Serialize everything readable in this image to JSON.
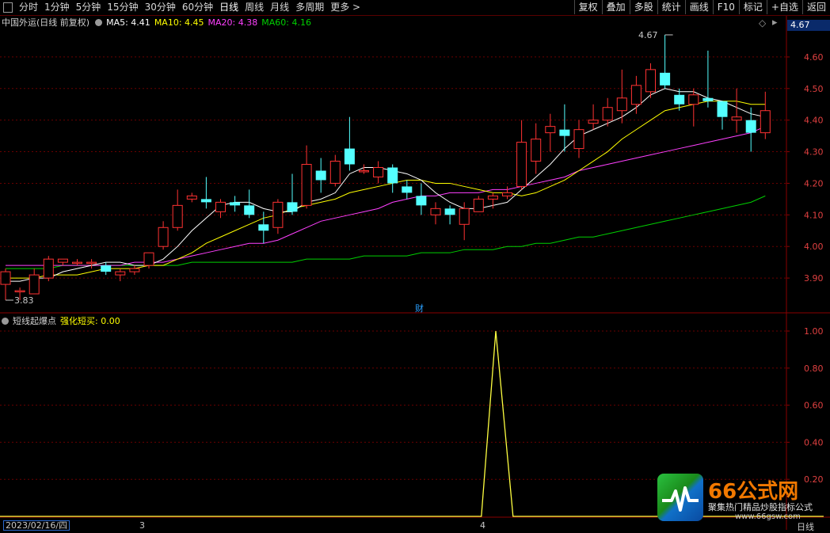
{
  "toolbar": {
    "left_items": [
      "分时",
      "1分钟",
      "5分钟",
      "15分钟",
      "30分钟",
      "60分钟",
      "日线",
      "周线",
      "月线",
      "多周期",
      "更多 >"
    ],
    "active_index": 6,
    "right_items": [
      "复权",
      "叠加",
      "多股",
      "统计",
      "画线",
      "F10",
      "标记",
      "+自选",
      "返回"
    ]
  },
  "main_panel": {
    "title": "中国外运(日线 前复权)",
    "ma5": "MA5: 4.41",
    "ma10": "MA10: 4.45",
    "ma20": "MA20: 4.38",
    "ma60": "MA60: 4.16",
    "current_price_badge": "4.67",
    "high_label": "4.67",
    "low_label": "3.83",
    "event_marker": "财",
    "y_ticks": [
      "4.60",
      "4.50",
      "4.40",
      "4.30",
      "4.20",
      "4.10",
      "4.00",
      "3.90"
    ]
  },
  "sub_panel": {
    "title": "短线起爆点",
    "value_label": "强化短买: 0.00",
    "y_ticks": [
      "1.00",
      "0.80",
      "0.60",
      "0.40",
      "0.20"
    ]
  },
  "bottom": {
    "date": "2023/02/16/四",
    "month_3": "3",
    "month_4": "4",
    "period": "日线"
  },
  "watermark": {
    "title": "66公式网",
    "subtitle": "聚集热门精品炒股指标公式",
    "url": "www.66gsw.com"
  },
  "colors": {
    "up": "#ff3232",
    "down": "#54ffff",
    "ma5": "#ffffff",
    "ma10": "#ffff00",
    "ma20": "#ff40ff",
    "ma60": "#00d000",
    "grid": "#6a0000"
  },
  "chart_data": {
    "type": "candlestick",
    "ylim": [
      3.83,
      4.67
    ],
    "candles": [
      [
        3.88,
        3.92,
        3.93,
        3.83
      ],
      [
        3.86,
        3.86,
        3.87,
        3.83
      ],
      [
        3.85,
        3.91,
        3.93,
        3.85
      ],
      [
        3.9,
        3.96,
        3.97,
        3.89
      ],
      [
        3.95,
        3.96,
        3.96,
        3.94
      ],
      [
        3.95,
        3.95,
        3.96,
        3.94
      ],
      [
        3.95,
        3.95,
        3.96,
        3.93
      ],
      [
        3.94,
        3.92,
        3.95,
        3.91
      ],
      [
        3.91,
        3.92,
        3.93,
        3.89
      ],
      [
        3.92,
        3.93,
        3.94,
        3.91
      ],
      [
        3.94,
        3.98,
        3.98,
        3.93
      ],
      [
        4.0,
        4.06,
        4.08,
        3.99
      ],
      [
        4.06,
        4.13,
        4.18,
        4.05
      ],
      [
        4.15,
        4.16,
        4.17,
        4.14
      ],
      [
        4.15,
        4.14,
        4.22,
        4.12
      ],
      [
        4.11,
        4.14,
        4.15,
        4.09
      ],
      [
        4.14,
        4.13,
        4.16,
        4.11
      ],
      [
        4.13,
        4.1,
        4.18,
        4.09
      ],
      [
        4.07,
        4.05,
        4.11,
        4.01
      ],
      [
        4.06,
        4.14,
        4.15,
        4.04
      ],
      [
        4.14,
        4.11,
        4.23,
        4.1
      ],
      [
        4.13,
        4.26,
        4.32,
        4.12
      ],
      [
        4.24,
        4.21,
        4.28,
        4.17
      ],
      [
        4.2,
        4.27,
        4.29,
        4.19
      ],
      [
        4.31,
        4.26,
        4.41,
        4.24
      ],
      [
        4.24,
        4.24,
        4.26,
        4.23
      ],
      [
        4.22,
        4.25,
        4.27,
        4.2
      ],
      [
        4.25,
        4.2,
        4.26,
        4.17
      ],
      [
        4.19,
        4.17,
        4.21,
        4.15
      ],
      [
        4.16,
        4.13,
        4.2,
        4.1
      ],
      [
        4.1,
        4.12,
        4.14,
        4.07
      ],
      [
        4.12,
        4.1,
        4.13,
        4.07
      ],
      [
        4.07,
        4.12,
        4.14,
        4.02
      ],
      [
        4.11,
        4.15,
        4.16,
        4.11
      ],
      [
        4.15,
        4.16,
        4.17,
        4.12
      ],
      [
        4.16,
        4.17,
        4.19,
        4.15
      ],
      [
        4.19,
        4.33,
        4.4,
        4.18
      ],
      [
        4.27,
        4.34,
        4.39,
        4.23
      ],
      [
        4.36,
        4.38,
        4.42,
        4.3
      ],
      [
        4.37,
        4.35,
        4.45,
        4.3
      ],
      [
        4.31,
        4.37,
        4.4,
        4.28
      ],
      [
        4.39,
        4.4,
        4.45,
        4.37
      ],
      [
        4.4,
        4.44,
        4.47,
        4.38
      ],
      [
        4.43,
        4.47,
        4.56,
        4.39
      ],
      [
        4.45,
        4.51,
        4.54,
        4.42
      ],
      [
        4.49,
        4.56,
        4.58,
        4.47
      ],
      [
        4.55,
        4.51,
        4.67,
        4.5
      ],
      [
        4.48,
        4.45,
        4.5,
        4.43
      ],
      [
        4.45,
        4.48,
        4.5,
        4.38
      ],
      [
        4.47,
        4.46,
        4.62,
        4.44
      ],
      [
        4.46,
        4.41,
        4.46,
        4.37
      ],
      [
        4.4,
        4.41,
        4.5,
        4.36
      ],
      [
        4.4,
        4.36,
        4.44,
        4.3
      ],
      [
        4.36,
        4.43,
        4.49,
        4.34
      ]
    ],
    "ma5": [
      3.89,
      3.89,
      3.9,
      3.9,
      3.92,
      3.93,
      3.94,
      3.95,
      3.95,
      3.94,
      3.94,
      3.96,
      4.0,
      4.05,
      4.09,
      4.13,
      4.14,
      4.14,
      4.12,
      4.11,
      4.11,
      4.14,
      4.15,
      4.17,
      4.23,
      4.25,
      4.25,
      4.24,
      4.23,
      4.21,
      4.17,
      4.14,
      4.12,
      4.12,
      4.13,
      4.14,
      4.18,
      4.22,
      4.26,
      4.31,
      4.35,
      4.37,
      4.39,
      4.41,
      4.44,
      4.48,
      4.5,
      4.49,
      4.49,
      4.47,
      4.46,
      4.44,
      4.42,
      4.41
    ],
    "ma10": [
      3.9,
      3.9,
      3.9,
      3.91,
      3.91,
      3.91,
      3.92,
      3.93,
      3.93,
      3.93,
      3.94,
      3.94,
      3.96,
      3.98,
      4.01,
      4.03,
      4.05,
      4.07,
      4.09,
      4.1,
      4.12,
      4.13,
      4.14,
      4.15,
      4.17,
      4.18,
      4.19,
      4.2,
      4.21,
      4.21,
      4.2,
      4.2,
      4.19,
      4.18,
      4.17,
      4.17,
      4.16,
      4.17,
      4.19,
      4.21,
      4.24,
      4.27,
      4.3,
      4.34,
      4.37,
      4.4,
      4.43,
      4.44,
      4.45,
      4.46,
      4.46,
      4.46,
      4.45,
      4.45
    ],
    "ma20": [
      3.94,
      3.94,
      3.94,
      3.94,
      3.94,
      3.94,
      3.94,
      3.94,
      3.94,
      3.95,
      3.95,
      3.95,
      3.96,
      3.97,
      3.98,
      3.99,
      4.0,
      4.01,
      4.01,
      4.02,
      4.04,
      4.06,
      4.08,
      4.09,
      4.1,
      4.11,
      4.12,
      4.14,
      4.15,
      4.16,
      4.16,
      4.17,
      4.17,
      4.17,
      4.18,
      4.18,
      4.19,
      4.2,
      4.21,
      4.22,
      4.24,
      4.25,
      4.26,
      4.27,
      4.28,
      4.29,
      4.3,
      4.31,
      4.32,
      4.33,
      4.34,
      4.35,
      4.36,
      4.38
    ],
    "ma60": [
      3.93,
      3.93,
      3.93,
      3.93,
      3.94,
      3.94,
      3.94,
      3.94,
      3.94,
      3.94,
      3.94,
      3.94,
      3.94,
      3.95,
      3.95,
      3.95,
      3.95,
      3.95,
      3.95,
      3.95,
      3.95,
      3.96,
      3.96,
      3.96,
      3.96,
      3.97,
      3.97,
      3.97,
      3.97,
      3.98,
      3.98,
      3.98,
      3.99,
      3.99,
      3.99,
      4.0,
      4.0,
      4.01,
      4.01,
      4.02,
      4.03,
      4.03,
      4.04,
      4.05,
      4.06,
      4.07,
      4.08,
      4.09,
      4.1,
      4.11,
      4.12,
      4.13,
      4.14,
      4.16
    ],
    "signal": [
      0,
      0,
      0,
      0,
      0,
      0,
      0,
      0,
      0,
      0,
      0,
      0,
      0,
      0,
      0,
      0,
      0,
      0,
      0,
      0,
      0,
      0,
      0,
      0,
      0,
      0,
      0,
      0,
      0,
      0,
      0,
      0,
      0,
      0,
      1,
      0,
      0,
      0,
      0,
      0,
      0,
      0,
      0,
      0,
      0,
      0,
      0,
      0,
      0,
      0,
      0,
      0,
      0,
      0
    ]
  }
}
